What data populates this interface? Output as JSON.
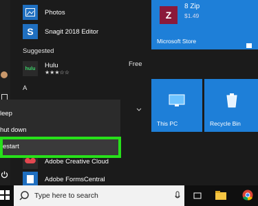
{
  "apps": {
    "photos": "Photos",
    "snagit": "Snagit 2018 Editor",
    "suggested": "Suggested",
    "hulu": "Hulu",
    "hulu_rating": "★★★☆☆",
    "hulu_price": "Free",
    "section_a": "A",
    "adobe_cc": "Adobe Creative Cloud",
    "adobe_fc": "Adobe FormsCentral"
  },
  "power_menu": {
    "sleep": "leep",
    "shutdown": "hut down",
    "restart": "estart"
  },
  "tiles": {
    "zip_title": "8 Zip",
    "zip_price": "$1.49",
    "store": "Microsoft Store",
    "this_pc": "This PC",
    "recycle_bin": "Recycle Bin"
  },
  "taskbar": {
    "search_placeholder": "Type here to search"
  },
  "colors": {
    "tile_blue": "#1e7fd8",
    "highlight_green": "#27e01a",
    "zip_red": "#8b1a3a"
  }
}
